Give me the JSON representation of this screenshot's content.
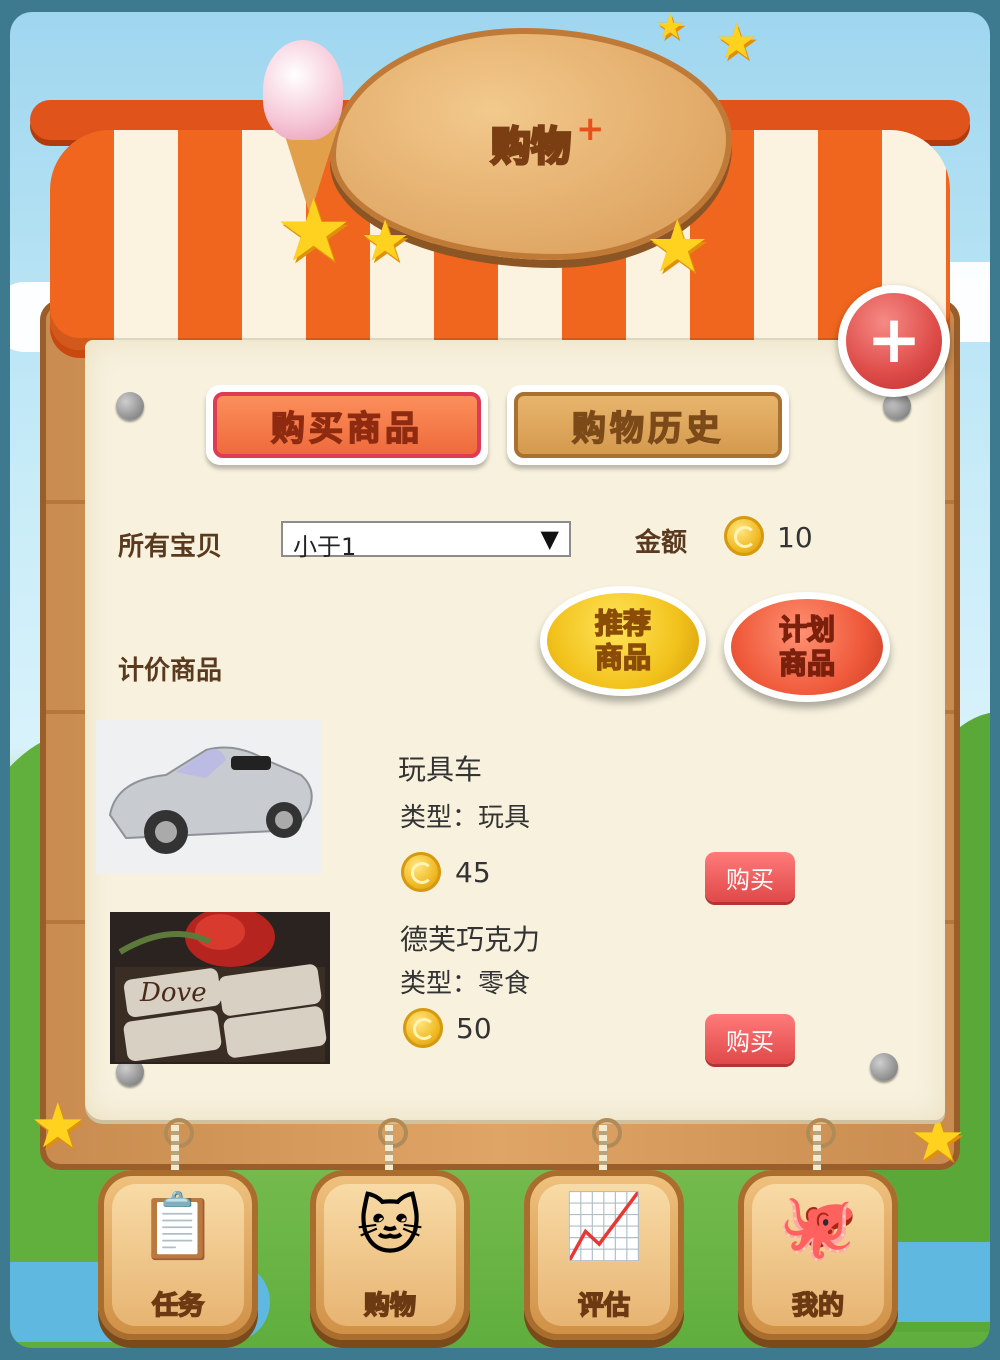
{
  "header": {
    "title": "购物"
  },
  "tabs": [
    {
      "label": "购买商品",
      "active": true
    },
    {
      "label": "购物历史",
      "active": false
    }
  ],
  "filter": {
    "category_label": "所有宝贝",
    "select_value": "小于1",
    "amount_label": "金额",
    "amount_value": "10"
  },
  "pricing": {
    "label": "计价商品",
    "recommend_button": "推荐\n商品",
    "plan_button": "计划\n商品"
  },
  "products": [
    {
      "name": "玩具车",
      "type": "类型：玩具",
      "price": "45",
      "buy_label": "购买",
      "image": "toy-car-image"
    },
    {
      "name": "德芙巧克力",
      "type": "类型：零食",
      "price": "50",
      "buy_label": "购买",
      "image": "chocolate-image",
      "brand_text": "Dove"
    }
  ],
  "bottom_nav": [
    {
      "label": "任务",
      "icon": "task-icon"
    },
    {
      "label": "购物",
      "icon": "shopping-cat-icon"
    },
    {
      "label": "评估",
      "icon": "chart-icon"
    },
    {
      "label": "我的",
      "icon": "octopus-icon"
    }
  ],
  "colors": {
    "awning_orange": "#f0661f",
    "paper": "#f7f1de",
    "buy_red": "#e04949",
    "coin_gold": "#f0b923"
  }
}
